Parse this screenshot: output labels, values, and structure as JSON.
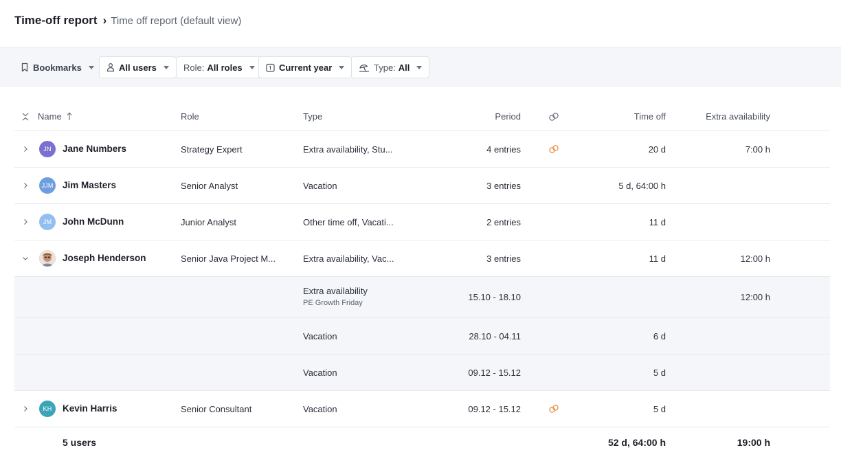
{
  "header": {
    "title": "Time-off report",
    "separator": "›",
    "view": "Time off report (default view)"
  },
  "toolbar": {
    "bookmarks": "Bookmarks",
    "users": "All users",
    "role_label": "Role:",
    "role_value": "All roles",
    "period": "Current year",
    "type_label": "Type:",
    "type_value": "All"
  },
  "table": {
    "columns": {
      "name": "Name",
      "role": "Role",
      "type": "Type",
      "period": "Period",
      "time_off": "Time off",
      "extra": "Extra availability"
    },
    "rows": [
      {
        "initials": "JN",
        "name": "Jane Numbers",
        "role": "Strategy Expert",
        "type": "Extra availability, Stu...",
        "period": "4 entries",
        "time_off": "20 d",
        "extra": "7:00 h",
        "avatar_color": "#7b6fd0"
      },
      {
        "initials": "JJM",
        "name": "Jim Masters",
        "role": "Senior Analyst",
        "type": "Vacation",
        "period": "3 entries",
        "time_off": "5 d, 64:00 h",
        "extra": "",
        "avatar_color": "#6e9ee0"
      },
      {
        "initials": "JM",
        "name": "John McDunn",
        "role": "Junior Analyst",
        "type": "Other time off, Vacati...",
        "period": "2 entries",
        "time_off": "11 d",
        "extra": "",
        "avatar_color": "#93bff0"
      },
      {
        "initials": "",
        "name": "Joseph Henderson",
        "role": "Senior Java Project M...",
        "type": "Extra availability, Vac...",
        "period": "3 entries",
        "time_off": "11 d",
        "extra": "12:00 h",
        "avatar_color": "#c79a7a"
      },
      {
        "initials": "KH",
        "name": "Kevin Harris",
        "role": "Senior Consultant",
        "type": "Vacation",
        "period": "09.12 - 15.12",
        "time_off": "5 d",
        "extra": "",
        "avatar_color": "#3aa5b8"
      }
    ],
    "sub_rows": [
      {
        "type": "Extra availability",
        "note": "PE Growth Friday",
        "period": "15.10 - 18.10",
        "time_off": "",
        "extra": "12:00 h"
      },
      {
        "type": "Vacation",
        "note": "",
        "period": "28.10 - 04.11",
        "time_off": "6 d",
        "extra": ""
      },
      {
        "type": "Vacation",
        "note": "",
        "period": "09.12 - 15.12",
        "time_off": "5 d",
        "extra": ""
      }
    ],
    "footer": {
      "users": "5 users",
      "time_off": "52 d, 64:00 h",
      "extra": "19:00 h"
    }
  },
  "colors": {
    "link_icon": "#e8883a",
    "toolbar_bg": "#f4f6f9",
    "subrow_bg": "#f4f6f9"
  }
}
